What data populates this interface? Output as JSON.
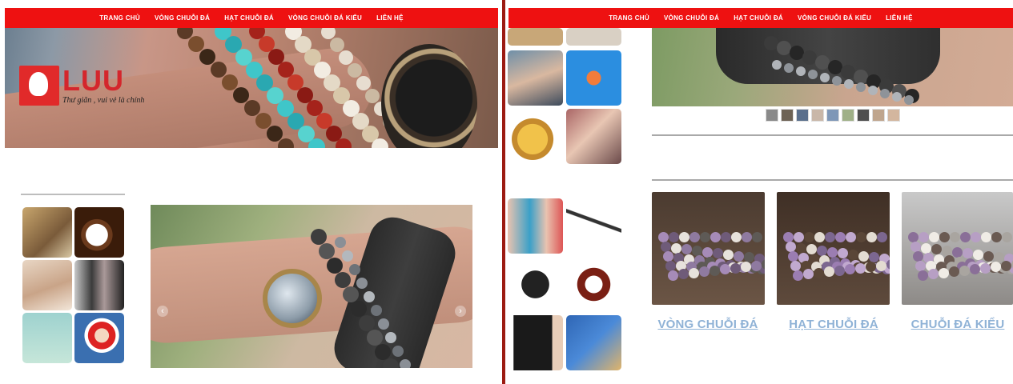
{
  "nav": [
    "TRANG CHỦ",
    "VÒNG CHUỖI ĐÁ",
    "HẠT CHUỖI ĐÁ",
    "VÒNG CHUỖI ĐÁ KIỂU",
    "LIÊN HỆ"
  ],
  "logo": {
    "name": "LUU",
    "slogan": "Thư giãn , vui vẻ là chính"
  },
  "slider": {
    "prev_glyph": "‹",
    "next_glyph": "›"
  },
  "categories": [
    "VÒNG CHUỖI ĐÁ",
    "HẠT CHUỖI ĐÁ",
    "CHUỖI ĐÁ KIỂU"
  ],
  "colors": {
    "nav_bg": "#ee1111",
    "divider": "#9c1b12",
    "link": "#8fb2d6",
    "logo_red": "#d4262c"
  }
}
